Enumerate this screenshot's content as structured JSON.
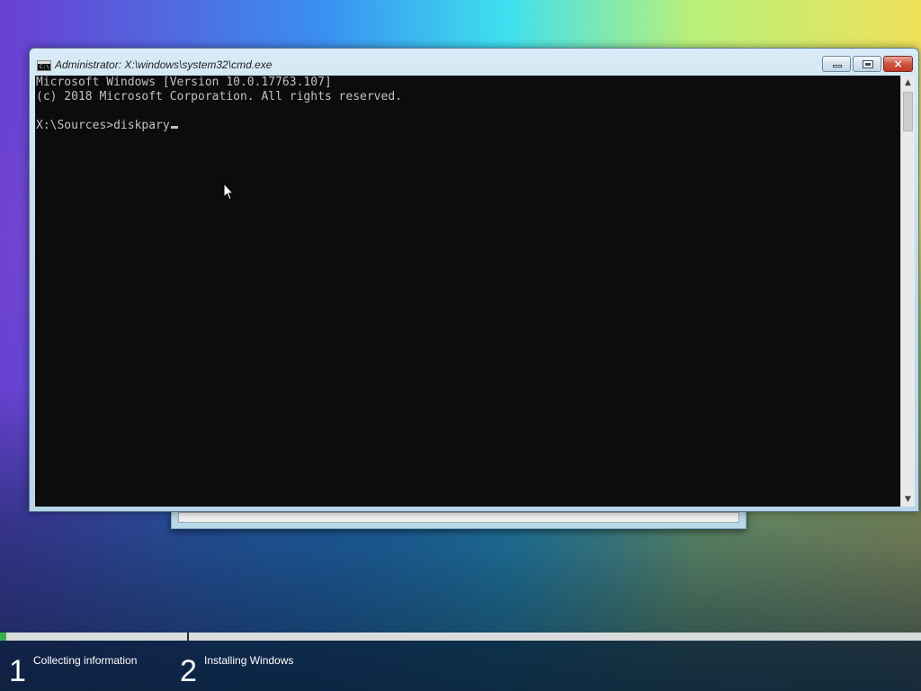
{
  "window": {
    "title": "Administrator: X:\\windows\\system32\\cmd.exe",
    "icon": "cmd-icon",
    "buttons": {
      "minimize": "minimize-icon",
      "maximize": "maximize-icon",
      "close": "×"
    }
  },
  "console": {
    "lines": [
      "Microsoft Windows [Version 10.0.17763.107]",
      "(c) 2018 Microsoft Corporation. All rights reserved.",
      "",
      "X:\\Sources>diskpary"
    ],
    "icon_prompt": "C:\\"
  },
  "scrollbar": {
    "up_arrow": "▲",
    "down_arrow": "▼"
  },
  "setup_progress": {
    "fill_color": "#3db04a",
    "progress_fraction": 0.007,
    "steps": [
      {
        "number": "1",
        "label": "Collecting information"
      },
      {
        "number": "2",
        "label": "Installing Windows"
      }
    ]
  }
}
